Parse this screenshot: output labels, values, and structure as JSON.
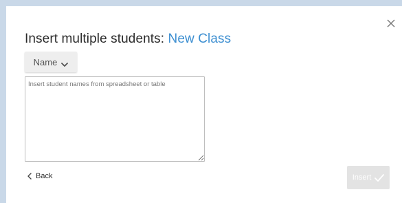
{
  "dialog": {
    "title_prefix": "Insert multiple students: ",
    "class_name": "New Class",
    "close_icon": "close-icon",
    "column_dropdown": {
      "selected": "Name",
      "icon": "chevron-down-icon"
    },
    "textarea": {
      "value": "",
      "placeholder": "Insert student names from spreadsheet or table"
    },
    "back_label": "Back",
    "insert_label": "Insert",
    "colors": {
      "accent": "#3d8fd1",
      "backdrop": "#c9d8e8",
      "disabled_button": "#e3e3e3"
    }
  }
}
